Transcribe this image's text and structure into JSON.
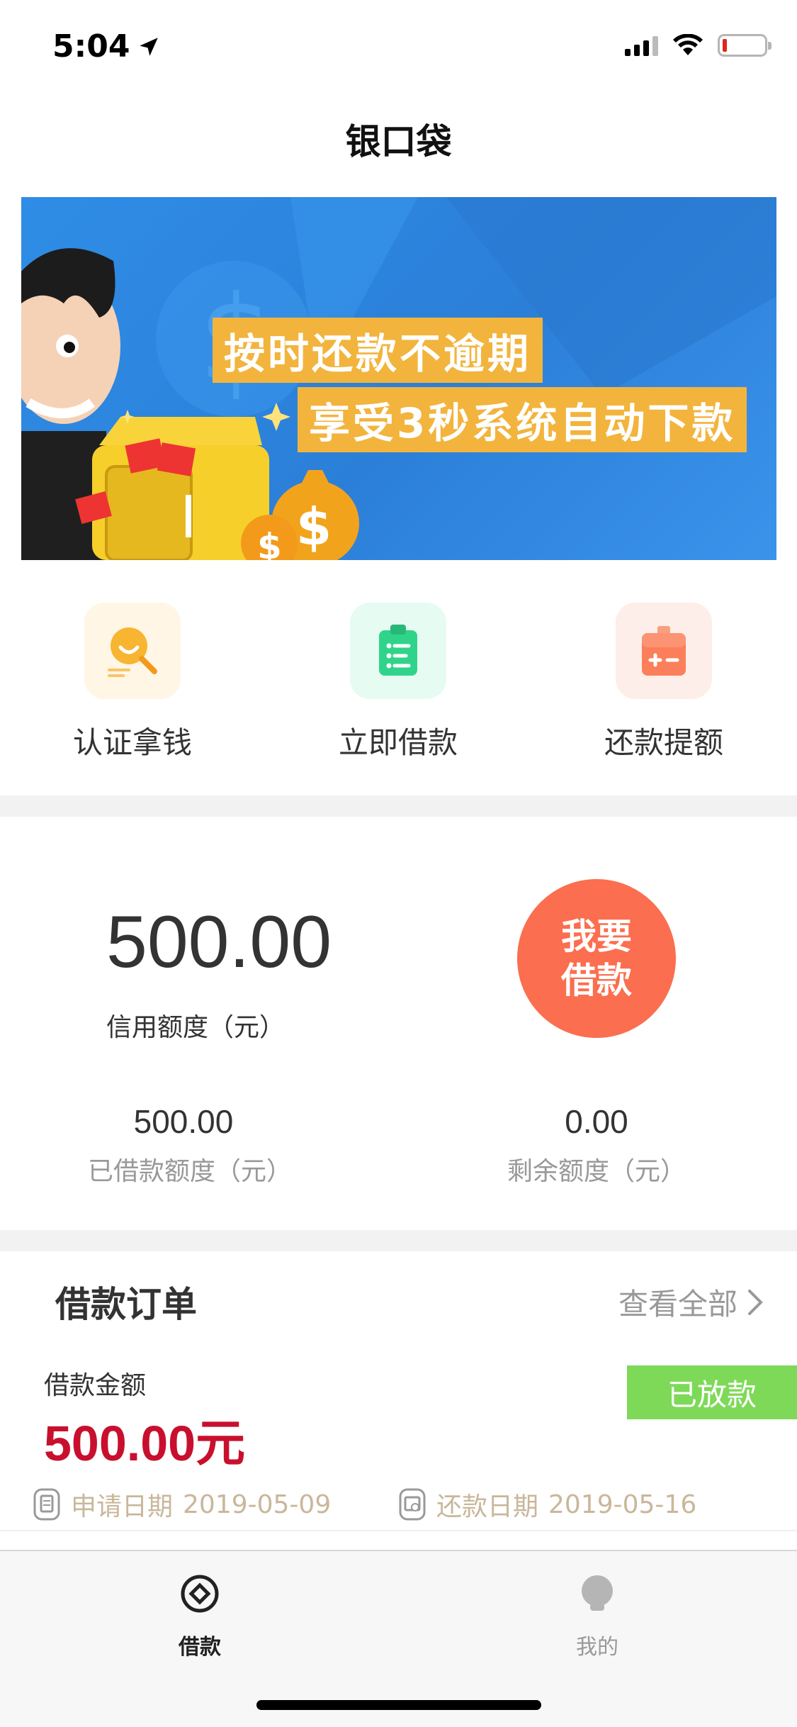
{
  "status_bar": {
    "time": "5:04",
    "icons": [
      "location-arrow-icon",
      "signal-icon",
      "wifi-icon",
      "battery-icon"
    ]
  },
  "nav": {
    "title": "银口袋"
  },
  "banner": {
    "line1": "按时还款不逾期",
    "line2": "享受3秒系统自动下款",
    "colors": {
      "background": "#2f8de6",
      "text_bg": "#f2b43d"
    }
  },
  "quick_menu": [
    {
      "label": "认证拿钱",
      "icon": "search-face-icon",
      "color": "#f5a623"
    },
    {
      "label": "立即借款",
      "icon": "clipboard-icon",
      "color": "#2fd48a"
    },
    {
      "label": "还款提额",
      "icon": "calculator-icon",
      "color": "#fb6e4f"
    }
  ],
  "credit": {
    "amount": "500.00",
    "label": "信用额度（元）",
    "borrow_button_line1": "我要",
    "borrow_button_line2": "借款",
    "borrowed_value": "500.00",
    "borrowed_label": "已借款额度（元）",
    "remaining_value": "0.00",
    "remaining_label": "剩余额度（元）"
  },
  "orders": {
    "title": "借款订单",
    "view_all": "查看全部",
    "item": {
      "amount_label": "借款金额",
      "amount": "500.00元",
      "status": "已放款",
      "apply_label": "申请日期",
      "apply_date": "2019-05-09",
      "repay_label": "还款日期",
      "repay_date": "2019-05-16"
    }
  },
  "tab_bar": {
    "tabs": [
      {
        "label": "借款",
        "icon": "loan-icon",
        "active": true
      },
      {
        "label": "我的",
        "icon": "profile-icon",
        "active": false
      }
    ]
  },
  "colors": {
    "accent": "#fb6e4f",
    "amount_red": "#c8102e",
    "status_green": "#7ed958",
    "muted": "#999999"
  }
}
